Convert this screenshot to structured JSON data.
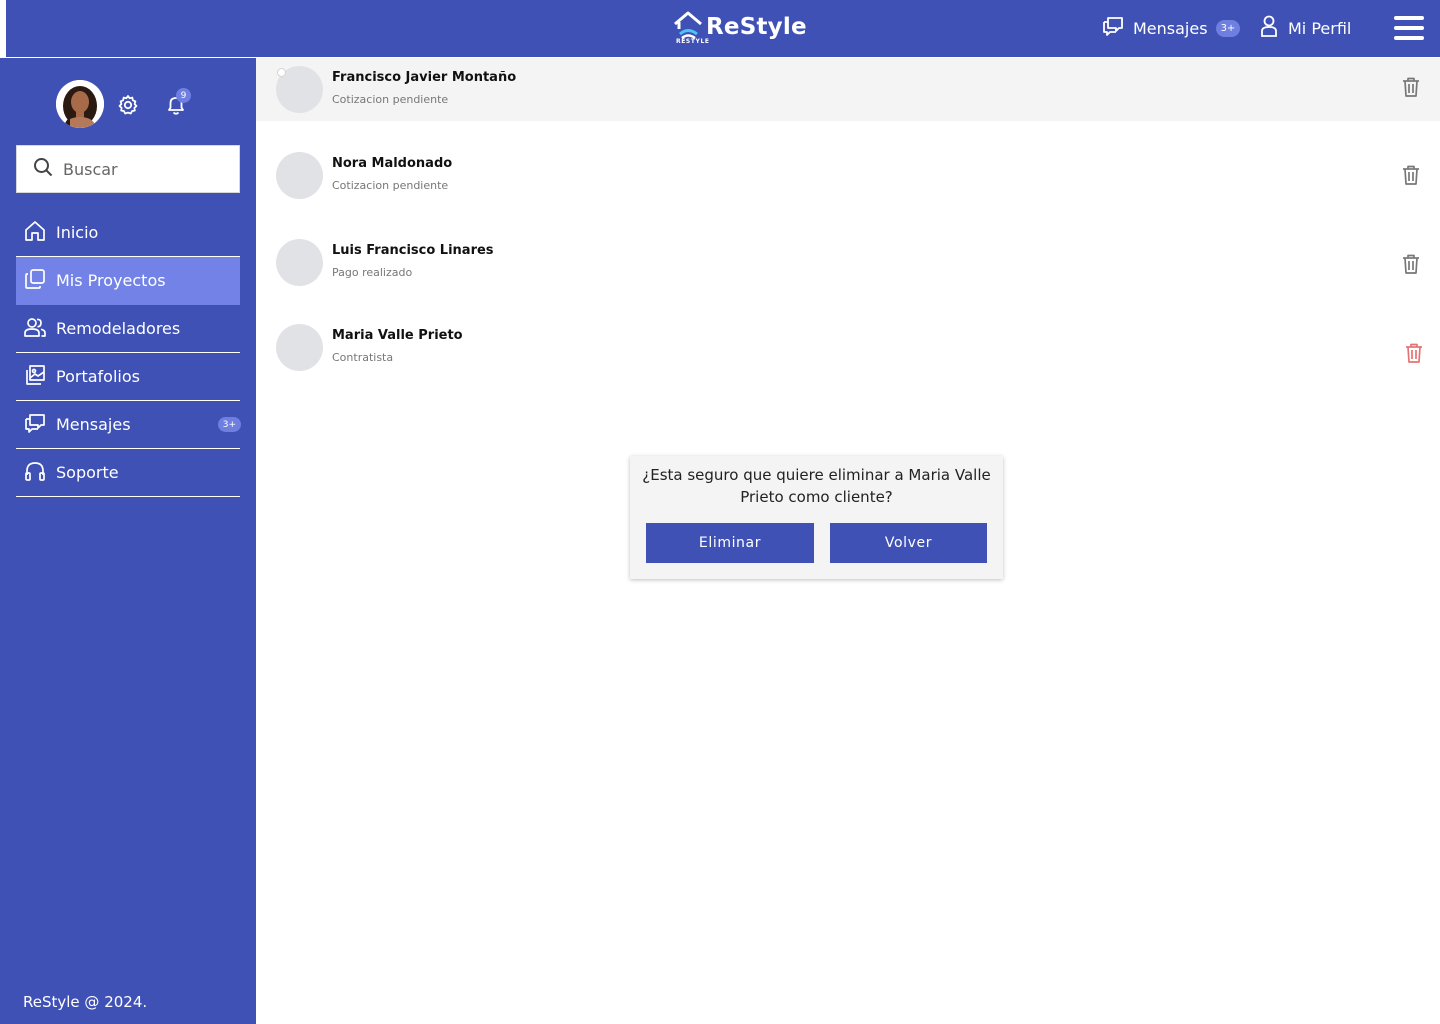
{
  "header": {
    "brand": "ReStyle",
    "brand_sub": "RESTYLE",
    "messages_label": "Mensajes",
    "messages_badge": "3+",
    "profile_label": "Mi Perfil"
  },
  "sidebar": {
    "notifications_badge": "9",
    "search_placeholder": "Buscar",
    "items": [
      {
        "label": "Inicio",
        "icon": "home-icon"
      },
      {
        "label": "Mis Proyectos",
        "icon": "projects-icon",
        "active": true
      },
      {
        "label": "Remodeladores",
        "icon": "users-icon"
      },
      {
        "label": "Portafolios",
        "icon": "gallery-icon"
      },
      {
        "label": "Mensajes",
        "icon": "chat-icon",
        "badge": "3+"
      },
      {
        "label": "Soporte",
        "icon": "headset-icon"
      }
    ],
    "footer": "ReStyle @ 2024."
  },
  "clients": [
    {
      "name": "Francisco Javier Montaño",
      "status": "Cotizacion pendiente"
    },
    {
      "name": "Nora Maldonado",
      "status": "Cotizacion pendiente"
    },
    {
      "name": "Luis Francisco Linares",
      "status": "Pago realizado"
    },
    {
      "name": "Maria Valle Prieto",
      "status": "Contratista"
    }
  ],
  "dialog": {
    "message": "¿Esta seguro que quiere eliminar a Maria Valle Prieto como cliente?",
    "confirm_label": "Eliminar",
    "cancel_label": "Volver"
  },
  "colors": {
    "primary": "#3f51b5",
    "active": "#7282e6",
    "danger": "#e57373"
  }
}
